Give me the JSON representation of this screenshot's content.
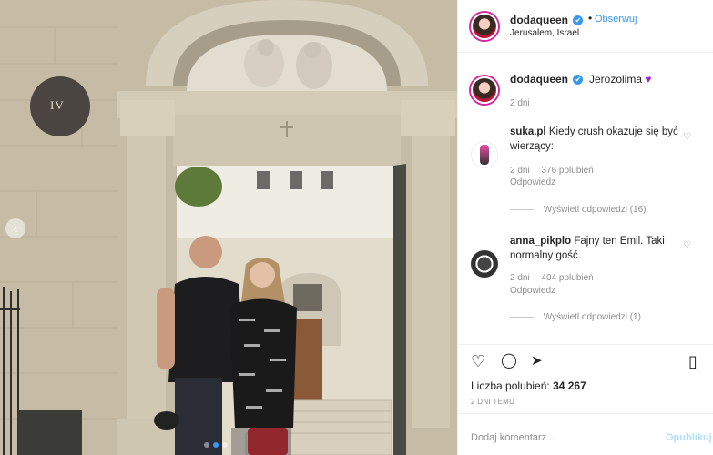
{
  "photo": {
    "plaque": "IV",
    "carousel_prev": "‹"
  },
  "header": {
    "username": "dodaqueen",
    "verified": "✔",
    "separator": "•",
    "follow": "Obserwuj",
    "location": "Jerusalem, Israel"
  },
  "caption": {
    "username": "dodaqueen",
    "verified": "✔",
    "text": "Jerozolima",
    "emoji": "♥",
    "time": "2 dni"
  },
  "comments": [
    {
      "username": "suka.pl",
      "text": "Kiedy crush okazuje się być wierzący:",
      "time": "2 dni",
      "likes": "376 polubień",
      "reply": "Odpowiedz",
      "show_replies": "Wyświetl odpowiedzi (16)"
    },
    {
      "username": "anna_pikplo",
      "text": "Fajny ten Emil. Taki normalny gość.",
      "time": "2 dni",
      "likes": "404 polubień",
      "reply": "Odpowiedz",
      "show_replies": "Wyświetl odpowiedzi (1)"
    }
  ],
  "actions": {
    "like_icon": "♡",
    "comment_icon": "◯",
    "share_icon": "➤",
    "save_icon": "▯"
  },
  "likes_label": "Liczba polubień:",
  "likes_count": "34 267",
  "posted_ago": "2 DNI TEMU",
  "add_comment": {
    "placeholder": "Dodaj komentarz...",
    "post_label": "Opublikuj"
  },
  "colors": {
    "accent": "#3897f0",
    "muted": "#8e8e8e"
  }
}
